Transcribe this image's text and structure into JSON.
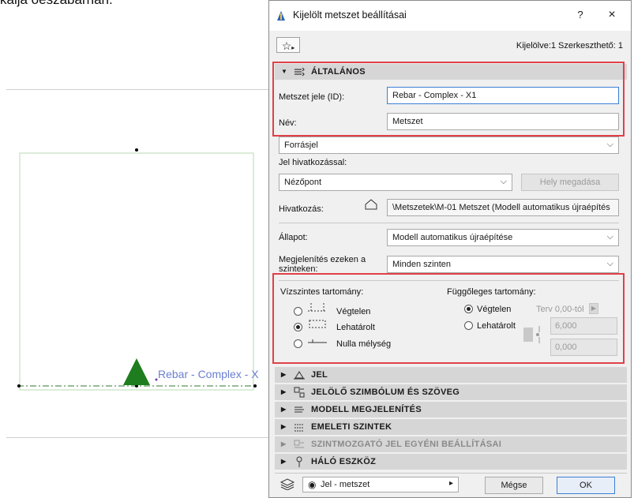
{
  "background": {
    "text_fragment": "kaija oeszabarhan.",
    "section_label": "Rebar - Complex - X"
  },
  "dialog": {
    "title": "Kijelölt metszet beállításai",
    "help": "?",
    "close": "×",
    "selection_info": "Kijelölve:1 Szerkeszthető: 1",
    "general": {
      "header": "ÁLTALÁNOS",
      "id_label": "Metszet jele (ID):",
      "id_value": "Rebar - Complex - X1",
      "name_label": "Név:",
      "name_value": "Metszet",
      "source_marker": "Forrásjel",
      "ref_marker_label": "Jel hivatkozással:",
      "ref_marker_value": "Nézőpont",
      "place_button": "Hely megadása",
      "reference_label": "Hivatkozás:",
      "reference_value": "\\Metszetek\\M-01 Metszet (Modell automatikus újraépítés",
      "status_label": "Állapot:",
      "status_value": "Modell automatikus újraépítése",
      "show_on_label": "Megjelenítés ezeken a szinteken:",
      "show_on_value": "Minden szinten"
    },
    "range": {
      "horizontal_title": "Vízszintes tartomány:",
      "h_infinite": "Végtelen",
      "h_limited": "Lehatárolt",
      "h_zero": "Nulla mélység",
      "vertical_title": "Függőleges tartomány:",
      "v_infinite": "Végtelen",
      "v_limited": "Lehatárolt",
      "v_from": "Terv 0,00-tól",
      "v_top": "6,000",
      "v_bottom": "0,000"
    },
    "sections": [
      {
        "label": "JEL",
        "icon": "marker-icon",
        "dim": false
      },
      {
        "label": "JELÖLŐ SZIMBÓLUM ÉS SZÖVEG",
        "icon": "symbol-text-icon",
        "dim": false
      },
      {
        "label": "MODELL MEGJELENÍTÉS",
        "icon": "model-display-icon",
        "dim": false
      },
      {
        "label": "EMELETI SZINTEK",
        "icon": "story-levels-icon",
        "dim": false
      },
      {
        "label": "SZINTMOZGATÓ JEL EGYÉNI BEÁLLÍTÁSAI",
        "icon": "level-marker-icon",
        "dim": true
      },
      {
        "label": "HÁLÓ ESZKÖZ",
        "icon": "grid-tool-icon",
        "dim": false
      }
    ],
    "footer": {
      "layer_value": "Jel - metszet",
      "cancel": "Mégse",
      "ok": "OK"
    }
  }
}
